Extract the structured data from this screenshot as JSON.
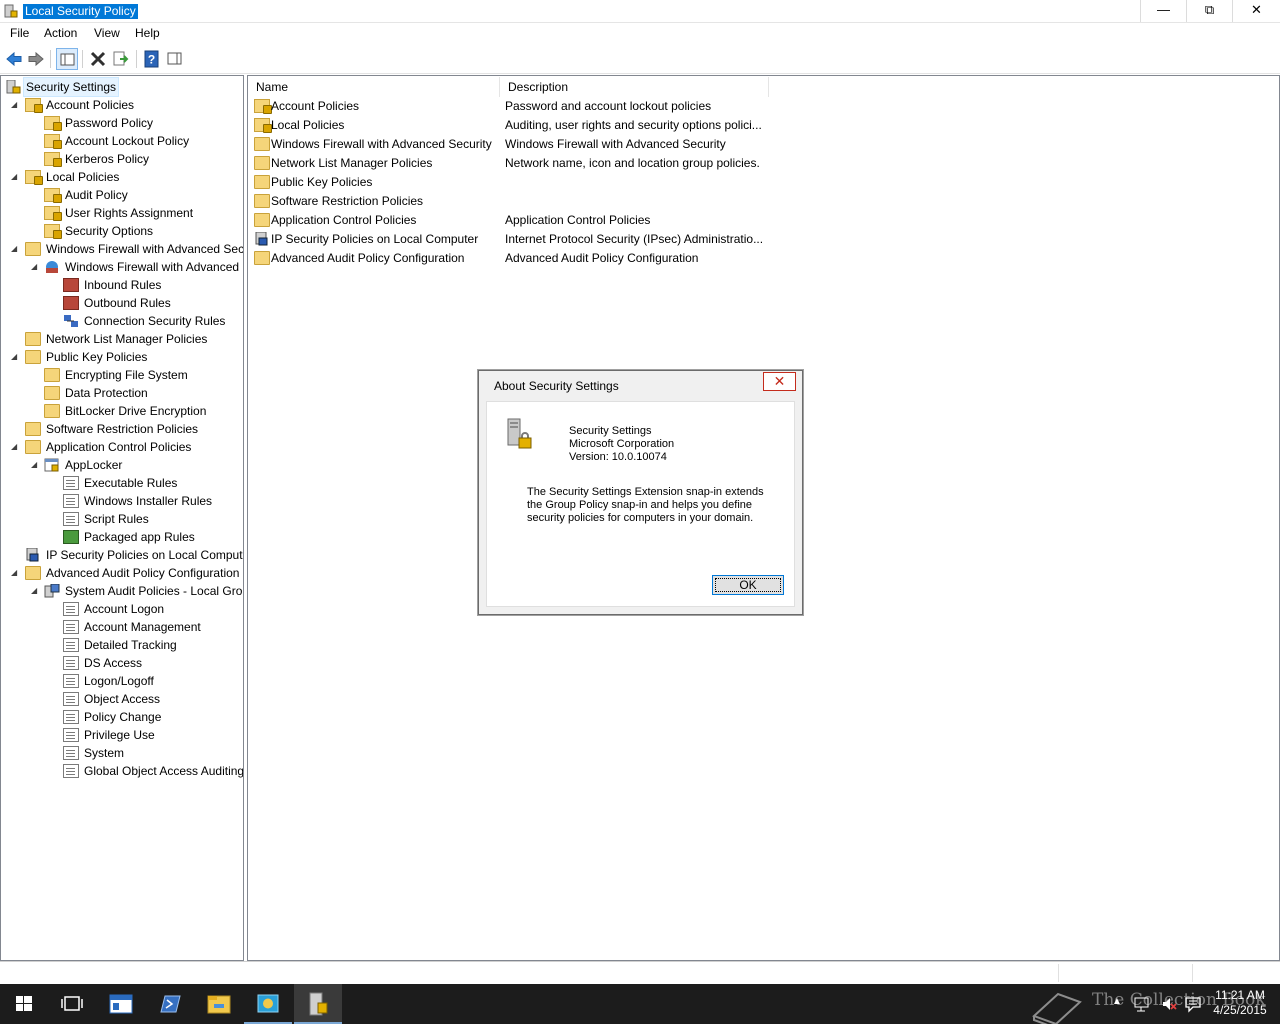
{
  "window": {
    "title": "Local Security Policy",
    "minimize": "—",
    "maximize": "⧉",
    "close": "✕"
  },
  "menu": [
    "File",
    "Action",
    "View",
    "Help"
  ],
  "toolbar": {
    "icons": [
      "back-icon",
      "forward-icon",
      "show-hide-tree-icon",
      "delete-icon",
      "export-list-icon",
      "help-icon",
      "show-hide-action-pane-icon"
    ]
  },
  "tree": {
    "root": "Security Settings",
    "items": [
      {
        "label": "Account Policies",
        "level": 1,
        "expanded": true,
        "icon": "folder-lock"
      },
      {
        "label": "Password Policy",
        "level": 2,
        "icon": "folder-lock"
      },
      {
        "label": "Account Lockout Policy",
        "level": 2,
        "icon": "folder-lock"
      },
      {
        "label": "Kerberos Policy",
        "level": 2,
        "icon": "folder-lock"
      },
      {
        "label": "Local Policies",
        "level": 1,
        "expanded": true,
        "icon": "folder-lock"
      },
      {
        "label": "Audit Policy",
        "level": 2,
        "icon": "folder-lock"
      },
      {
        "label": "User Rights Assignment",
        "level": 2,
        "icon": "folder-lock"
      },
      {
        "label": "Security Options",
        "level": 2,
        "icon": "folder-lock"
      },
      {
        "label": "Windows Firewall with Advanced Secu",
        "level": 1,
        "expanded": true,
        "icon": "folder"
      },
      {
        "label": "Windows Firewall with Advanced",
        "level": 2,
        "expanded": true,
        "icon": "firewall"
      },
      {
        "label": "Inbound Rules",
        "level": 3,
        "icon": "rules-red"
      },
      {
        "label": "Outbound Rules",
        "level": 3,
        "icon": "rules-red"
      },
      {
        "label": "Connection Security Rules",
        "level": 3,
        "icon": "connection"
      },
      {
        "label": "Network List Manager Policies",
        "level": 1,
        "icon": "folder"
      },
      {
        "label": "Public Key Policies",
        "level": 1,
        "expanded": true,
        "icon": "folder"
      },
      {
        "label": "Encrypting File System",
        "level": 2,
        "icon": "folder"
      },
      {
        "label": "Data Protection",
        "level": 2,
        "icon": "folder"
      },
      {
        "label": "BitLocker Drive Encryption",
        "level": 2,
        "icon": "folder"
      },
      {
        "label": "Software Restriction Policies",
        "level": 1,
        "icon": "folder"
      },
      {
        "label": "Application Control Policies",
        "level": 1,
        "expanded": true,
        "icon": "folder"
      },
      {
        "label": "AppLocker",
        "level": 2,
        "expanded": true,
        "icon": "applocker"
      },
      {
        "label": "Executable Rules",
        "level": 3,
        "icon": "doc"
      },
      {
        "label": "Windows Installer Rules",
        "level": 3,
        "icon": "doc"
      },
      {
        "label": "Script Rules",
        "level": 3,
        "icon": "doc"
      },
      {
        "label": "Packaged app Rules",
        "level": 3,
        "icon": "packaged"
      },
      {
        "label": "IP Security Policies on Local Compute",
        "level": 1,
        "icon": "ipsec"
      },
      {
        "label": "Advanced Audit Policy Configuration",
        "level": 1,
        "expanded": true,
        "icon": "folder"
      },
      {
        "label": "System Audit Policies - Local Grou",
        "level": 2,
        "expanded": true,
        "icon": "audit"
      },
      {
        "label": "Account Logon",
        "level": 3,
        "icon": "doc"
      },
      {
        "label": "Account Management",
        "level": 3,
        "icon": "doc"
      },
      {
        "label": "Detailed Tracking",
        "level": 3,
        "icon": "doc"
      },
      {
        "label": "DS Access",
        "level": 3,
        "icon": "doc"
      },
      {
        "label": "Logon/Logoff",
        "level": 3,
        "icon": "doc"
      },
      {
        "label": "Object Access",
        "level": 3,
        "icon": "doc"
      },
      {
        "label": "Policy Change",
        "level": 3,
        "icon": "doc"
      },
      {
        "label": "Privilege Use",
        "level": 3,
        "icon": "doc"
      },
      {
        "label": "System",
        "level": 3,
        "icon": "doc"
      },
      {
        "label": "Global Object Access Auditing",
        "level": 3,
        "icon": "doc"
      }
    ]
  },
  "detail": {
    "columns": [
      "Name",
      "Description"
    ],
    "rows": [
      {
        "name": "Account Policies",
        "description": "Password and account lockout policies",
        "icon": "folder-lock"
      },
      {
        "name": "Local Policies",
        "description": "Auditing, user rights and security options polici...",
        "icon": "folder-lock"
      },
      {
        "name": "Windows Firewall with Advanced Security",
        "description": "Windows Firewall with Advanced Security",
        "icon": "folder"
      },
      {
        "name": "Network List Manager Policies",
        "description": "Network name, icon and location group policies.",
        "icon": "folder"
      },
      {
        "name": "Public Key Policies",
        "description": "",
        "icon": "folder"
      },
      {
        "name": "Software Restriction Policies",
        "description": "",
        "icon": "folder"
      },
      {
        "name": "Application Control Policies",
        "description": "Application Control Policies",
        "icon": "folder"
      },
      {
        "name": "IP Security Policies on Local Computer",
        "description": "Internet Protocol Security (IPsec) Administratio...",
        "icon": "ipsec"
      },
      {
        "name": "Advanced Audit Policy Configuration",
        "description": "Advanced Audit Policy Configuration",
        "icon": "folder"
      }
    ]
  },
  "dialog": {
    "title": "About Security Settings",
    "close": "✕",
    "product": "Security Settings",
    "company": "Microsoft Corporation",
    "version": "Version: 10.0.10074",
    "description_lines": [
      "The Security Settings Extension snap-in extends",
      "the Group Policy snap-in and helps you define",
      "security policies for computers in your domain."
    ],
    "ok": "OK"
  },
  "taskbar": {
    "clock_time": "11:21 AM",
    "clock_date": "4/25/2015",
    "watermark": "The Collection Book"
  }
}
